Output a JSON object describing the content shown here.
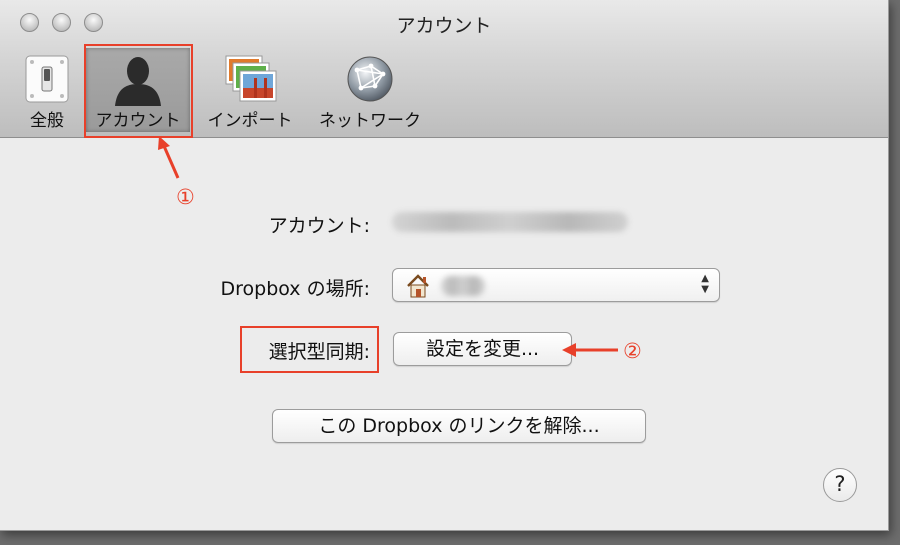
{
  "window": {
    "title": "アカウント"
  },
  "toolbar": {
    "items": [
      {
        "label": "全般",
        "icon": "light-switch-icon"
      },
      {
        "label": "アカウント",
        "icon": "user-silhouette-icon",
        "selected": true
      },
      {
        "label": "インポート",
        "icon": "photos-import-icon"
      },
      {
        "label": "ネットワーク",
        "icon": "network-globe-icon"
      }
    ]
  },
  "account": {
    "label": "アカウント:",
    "value_hidden": true
  },
  "location": {
    "label": "Dropbox の場所:",
    "value_hidden": true,
    "icon": "home-icon"
  },
  "selective_sync": {
    "label": "選択型同期:",
    "button_label": "設定を変更..."
  },
  "unlink": {
    "button_label": "この Dropbox のリンクを解除..."
  },
  "help": {
    "label": "?"
  },
  "annotations": {
    "step1": "①",
    "step2": "②",
    "color": "#e8402a"
  }
}
